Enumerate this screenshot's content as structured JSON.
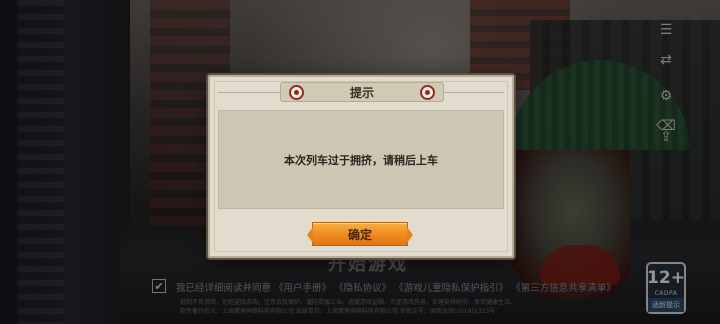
{
  "dialog": {
    "title": "提示",
    "message": "本次列车过于拥挤，请稍后上车",
    "confirm_label": "确定"
  },
  "background": {
    "start_game": "开始游戏",
    "agreement_prefix": "我已经详细阅读并同意",
    "agreement_links": [
      "《用户手册》",
      "《隐私协议》",
      "《游戏儿童隐私保护指引》",
      "《第三方信息共享清单》"
    ],
    "fine_print_1": "抵制不良游戏，拒绝盗版游戏。注意自我保护，谨防受骗上当。适度游戏益脑，沉迷游戏伤身。合理安排时间，享受健康生活。",
    "fine_print_2": "软件著作权人：上海鹰角网络科技有限公司 出版单位：上海鹰角网络科技有限公司 审批文号：国新出审[2019]2323号"
  },
  "age_rating": {
    "number": "12+",
    "org": "CADPA",
    "tip": "适龄提示"
  },
  "side_icons": [
    "notice-icon",
    "account-switch-icon",
    "settings-icon",
    "clear-cache-icon",
    "upload-log-icon"
  ],
  "colors": {
    "accent_orange": "#ee8a1d",
    "dialog_bg": "#e1dccd",
    "ornament_red": "#8f2c22"
  }
}
